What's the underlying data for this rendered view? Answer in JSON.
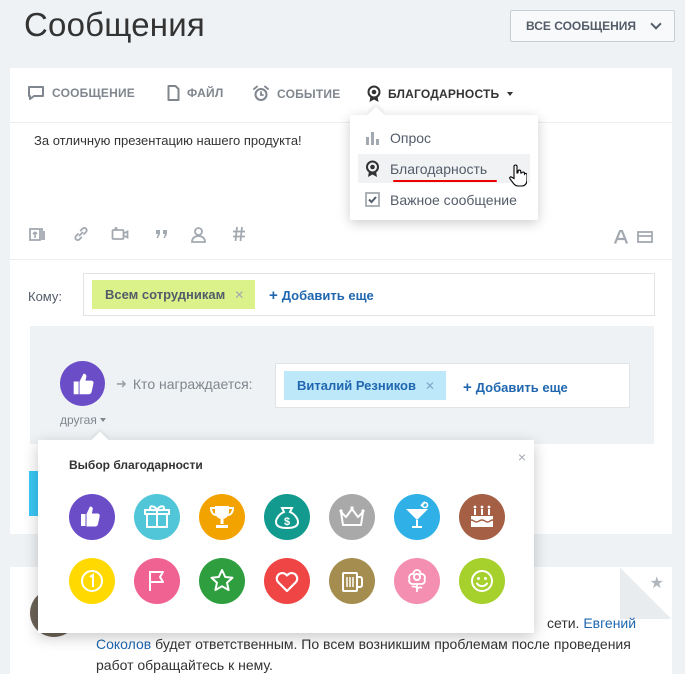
{
  "page": {
    "title": "Сообщения",
    "filter_label": "ВСЕ СООБЩЕНИЯ"
  },
  "tabs": [
    {
      "label": "СООБЩЕНИЕ",
      "icon": "message-icon"
    },
    {
      "label": "ФАЙЛ",
      "icon": "file-icon"
    },
    {
      "label": "СОБЫТИЕ",
      "icon": "alarm-clock-icon"
    },
    {
      "label": "БЛАГОДАРНОСТЬ",
      "icon": "award-medal-icon",
      "active": true
    }
  ],
  "post": {
    "text": "За отличную презентацию нашего продукта!"
  },
  "toolbar": {
    "icons": [
      "file-upload-icon",
      "link-icon",
      "video-icon",
      "quote-icon",
      "mention-user-icon",
      "hashtag-icon"
    ],
    "right_icons": [
      "text-format-icon",
      "panel-toggle-icon"
    ]
  },
  "recipients": {
    "label": "Кому:",
    "selected": "Всем сотрудникам",
    "add_more": "Добавить еще"
  },
  "gratitude": {
    "type_label": "другая",
    "who_label": "Кто награждается:",
    "selected": "Виталий Резников",
    "add_more": "Добавить еще"
  },
  "more_menu": {
    "items": [
      {
        "label": "Опрос",
        "icon": "poll-chart-icon"
      },
      {
        "label": "Благодарность",
        "icon": "award-medal-icon",
        "hover": true
      },
      {
        "label": "Важное сообщение",
        "icon": "important-check-icon"
      }
    ]
  },
  "picker": {
    "title": "Выбор благодарности",
    "close": "×",
    "badges": [
      {
        "name": "thumbs-up",
        "color": "#6b4ec7"
      },
      {
        "name": "gift",
        "color": "#50c6d8"
      },
      {
        "name": "cup",
        "color": "#f2a300"
      },
      {
        "name": "money",
        "color": "#119a8d"
      },
      {
        "name": "crown",
        "color": "#a9a9a9"
      },
      {
        "name": "drink",
        "color": "#2fb1e8"
      },
      {
        "name": "cake",
        "color": "#a45f44"
      },
      {
        "name": "number-one",
        "color": "#ffd900"
      },
      {
        "name": "flag",
        "color": "#f06292"
      },
      {
        "name": "star",
        "color": "#2e9e3f"
      },
      {
        "name": "heart",
        "color": "#f04545"
      },
      {
        "name": "beer",
        "color": "#a58d4f"
      },
      {
        "name": "flower",
        "color": "#f48fb1"
      },
      {
        "name": "smile",
        "color": "#a6d02c"
      }
    ]
  },
  "feed": {
    "text_part1": "сети. ",
    "link1": "Евгений",
    "link2": "Соколов",
    "text_part2": " будет ответственным. По всем возникшим проблемам после проведения работ обращайтесь к нему."
  }
}
